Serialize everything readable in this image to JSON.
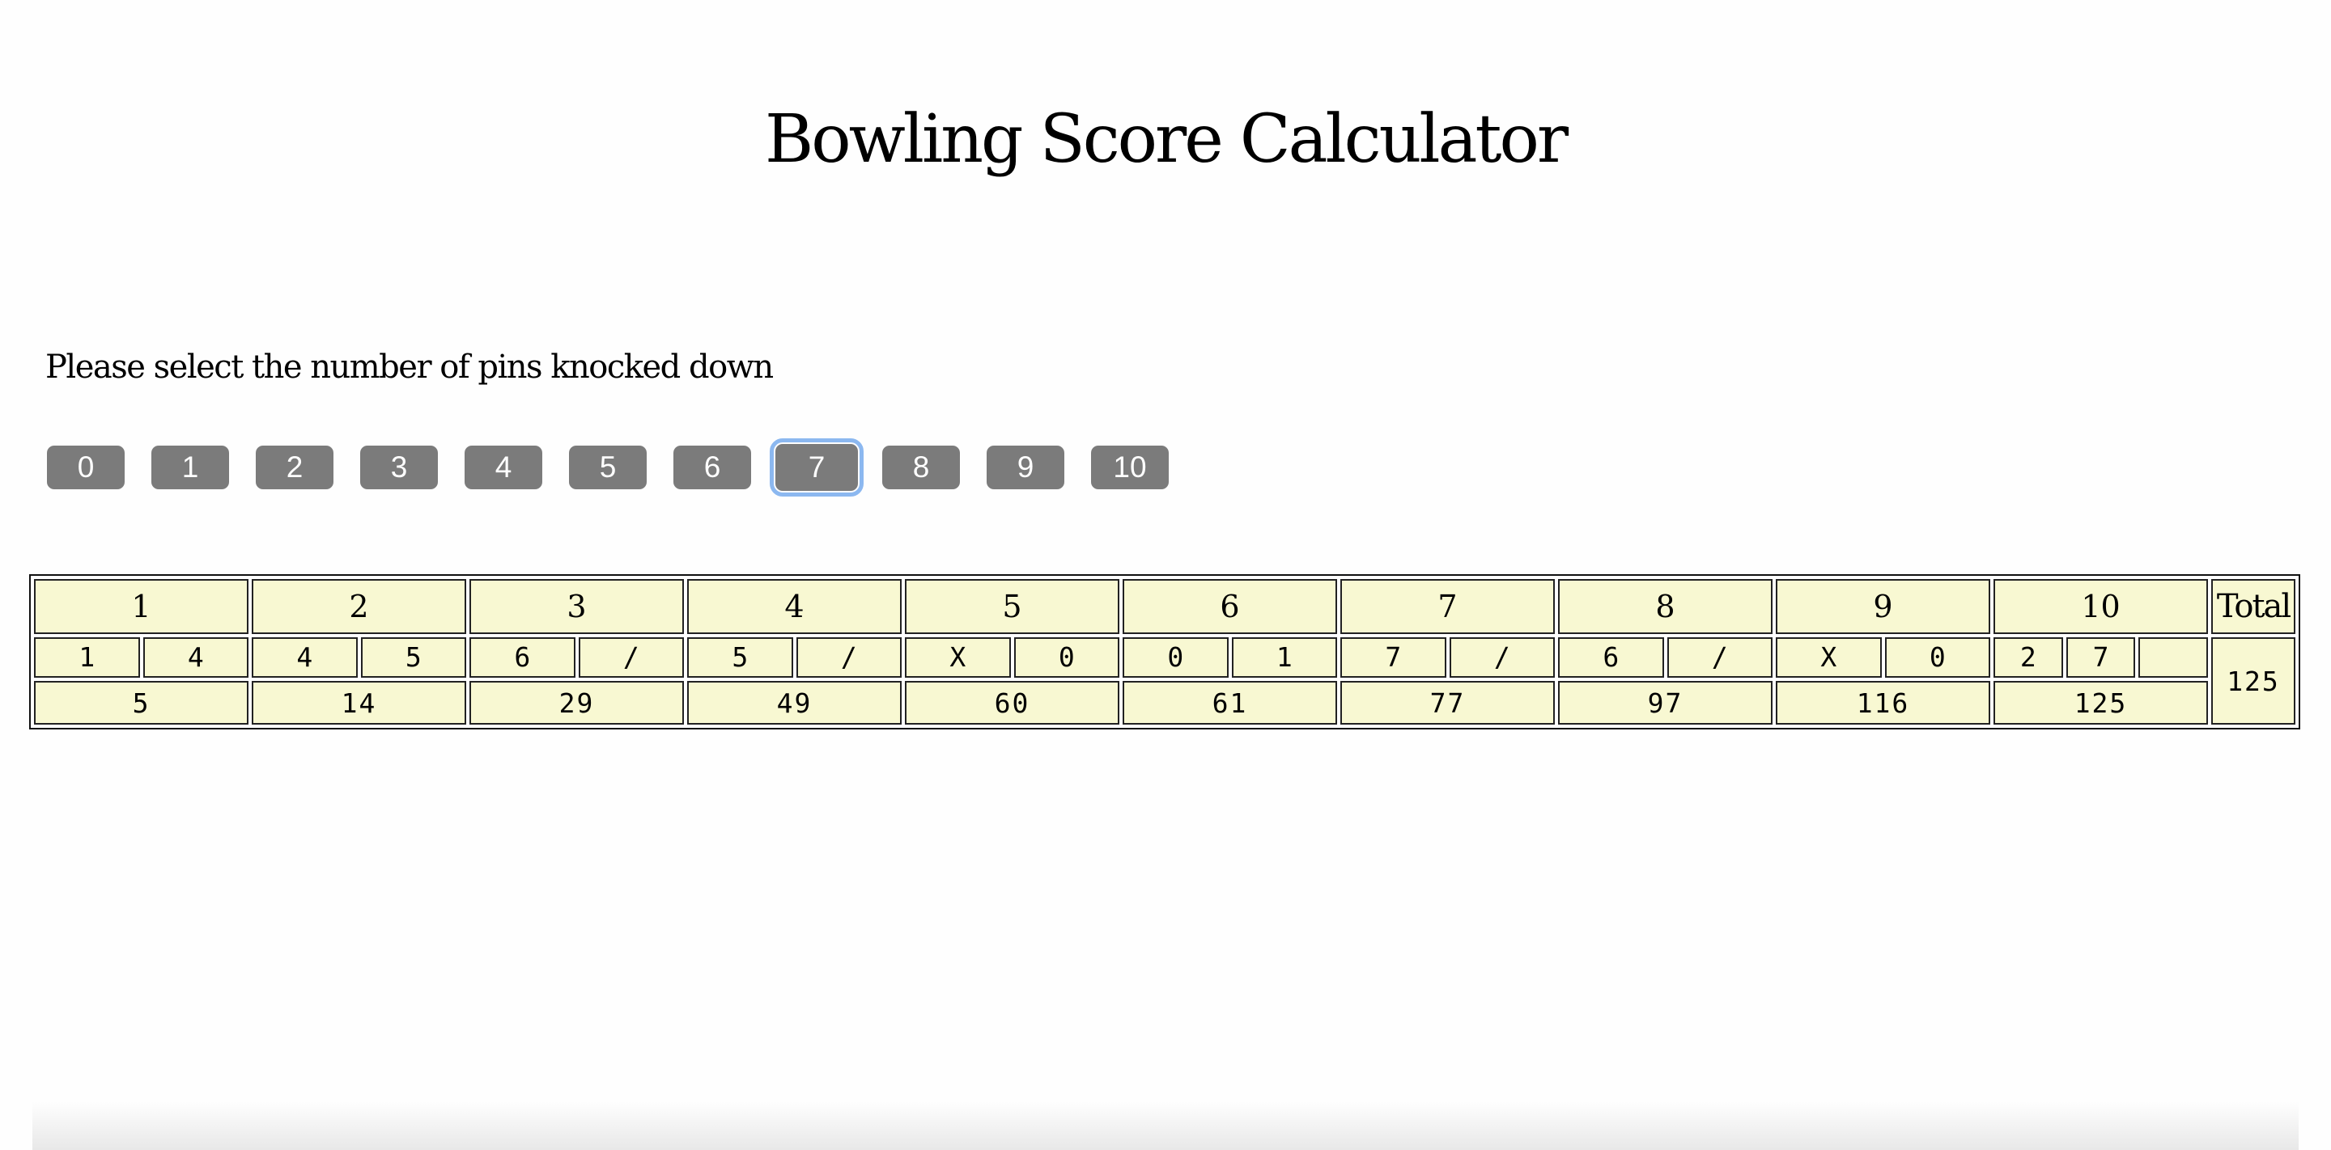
{
  "title": "Bowling Score Calculator",
  "prompt": "Please select the number of pins knocked down",
  "pin_buttons": [
    "0",
    "1",
    "2",
    "3",
    "4",
    "5",
    "6",
    "7",
    "8",
    "9",
    "10"
  ],
  "selected_pin": "7",
  "scorecard": {
    "frames": [
      {
        "label": "1",
        "rolls": [
          "1",
          "4"
        ],
        "score": "5"
      },
      {
        "label": "2",
        "rolls": [
          "4",
          "5"
        ],
        "score": "14"
      },
      {
        "label": "3",
        "rolls": [
          "6",
          "/"
        ],
        "score": "29"
      },
      {
        "label": "4",
        "rolls": [
          "5",
          "/"
        ],
        "score": "49"
      },
      {
        "label": "5",
        "rolls": [
          "X",
          "0"
        ],
        "score": "60"
      },
      {
        "label": "6",
        "rolls": [
          "0",
          "1"
        ],
        "score": "61"
      },
      {
        "label": "7",
        "rolls": [
          "7",
          "/"
        ],
        "score": "77"
      },
      {
        "label": "8",
        "rolls": [
          "6",
          "/"
        ],
        "score": "97"
      },
      {
        "label": "9",
        "rolls": [
          "X",
          "0"
        ],
        "score": "116"
      },
      {
        "label": "10",
        "rolls": [
          "2",
          "7",
          ""
        ],
        "score": "125"
      }
    ],
    "total_label": "Total",
    "total_value": "125"
  },
  "colors": {
    "cell_background": "#f8f8d2",
    "button_background": "#7b7b7b",
    "focus_ring": "#8cb8f0"
  }
}
